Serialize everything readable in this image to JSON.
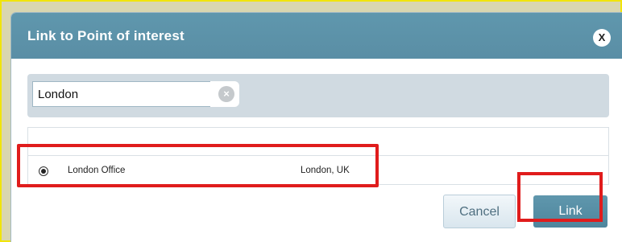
{
  "dialog": {
    "title": "Link to Point of interest",
    "close_label": "X"
  },
  "search": {
    "value": "London",
    "clear_icon": "clear-icon",
    "clear_label": "×"
  },
  "results": [
    {
      "name": "London Office",
      "location": "London, UK",
      "selected": true
    }
  ],
  "buttons": {
    "cancel_label": "Cancel",
    "link_label": "Link"
  },
  "colors": {
    "titlebar": "#5a8ea5",
    "link_button": "#4f869d",
    "annotation_red": "#e01c1c",
    "outer_border": "#f1e40a"
  }
}
